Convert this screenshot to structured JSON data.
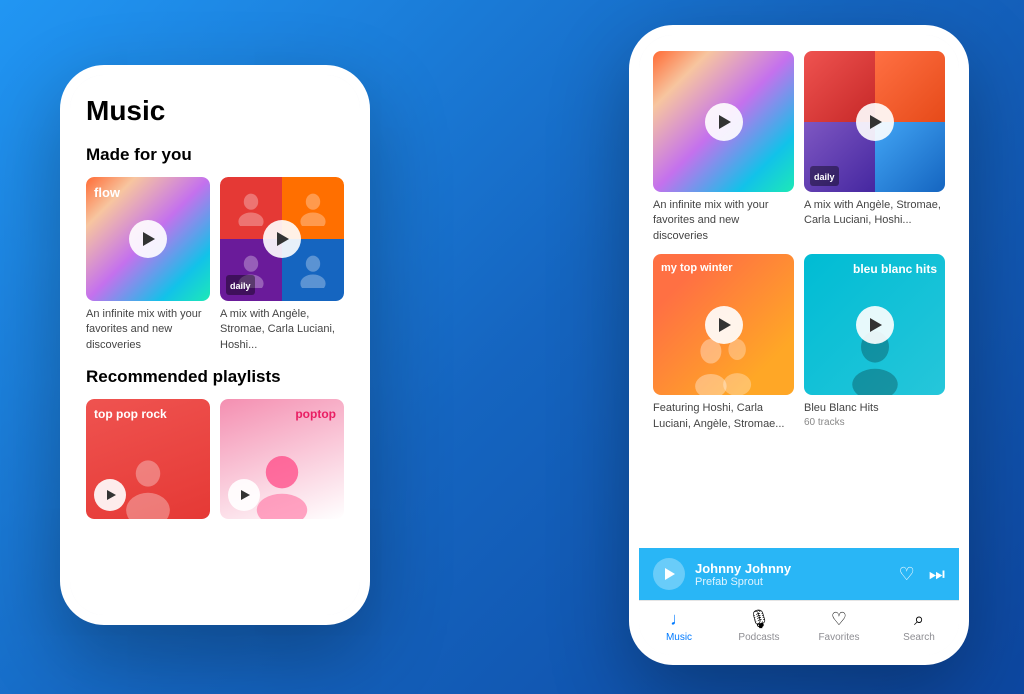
{
  "background": {
    "gradient_start": "#2196F3",
    "gradient_end": "#0D47A1"
  },
  "left_phone": {
    "title": "Music",
    "section1": "Made for you",
    "section2": "Recommended playlists",
    "card_flow": {
      "label": "flow",
      "description": "An infinite mix with your favorites and new discoveries"
    },
    "card_daily": {
      "label": "daily",
      "description": "A mix with Angèle, Stromae, Carla Luciani, Hoshi..."
    },
    "card_rock": {
      "label": "top pop rock"
    },
    "card_poptop": {
      "label": "poptop"
    }
  },
  "right_phone": {
    "card_mix1": {
      "description": "An infinite mix with your favorites and new discoveries"
    },
    "card_daily": {
      "label": "daily",
      "description": "A mix with Angèle, Stromae, Carla Luciani, Hoshi..."
    },
    "card_winter": {
      "label": "my top winter",
      "description": "Featuring Hoshi, Carla Luciani, Angèle, Stromae..."
    },
    "card_bleu": {
      "label": "bleu blanc hits",
      "description": "Bleu Blanc Hits",
      "tracks": "60 tracks"
    },
    "now_playing": {
      "title": "Johnny Johnny",
      "artist": "Prefab Sprout"
    },
    "tabs": [
      {
        "label": "Music",
        "icon": "♩",
        "active": true
      },
      {
        "label": "Podcasts",
        "icon": "🎙",
        "active": false
      },
      {
        "label": "Favorites",
        "icon": "♡",
        "active": false
      },
      {
        "label": "Search",
        "icon": "🔍",
        "active": false
      }
    ]
  }
}
